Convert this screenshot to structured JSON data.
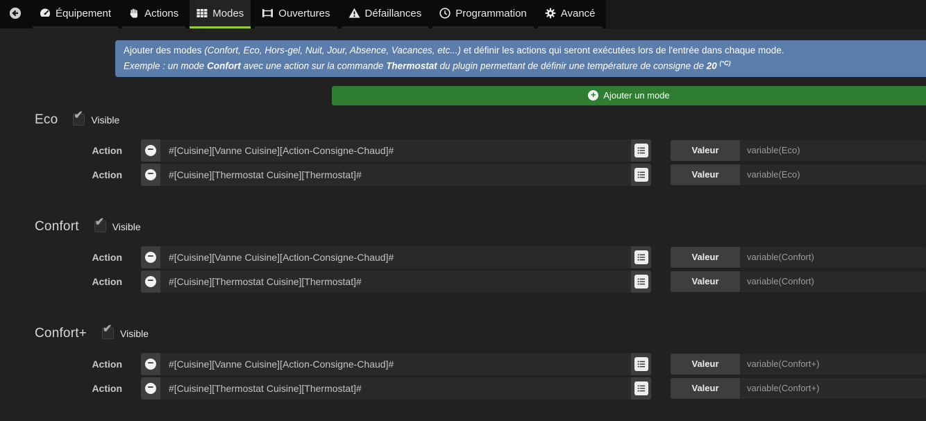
{
  "nav": {
    "back_icon": "arrow-circle-left",
    "tabs": [
      {
        "label": "Équipement",
        "icon": "tachometer",
        "active": false
      },
      {
        "label": "Actions",
        "icon": "hand",
        "active": false
      },
      {
        "label": "Modes",
        "icon": "table-grid",
        "active": true
      },
      {
        "label": "Ouvertures",
        "icon": "window-frame",
        "active": false
      },
      {
        "label": "Défaillances",
        "icon": "warning-triangle",
        "active": false
      },
      {
        "label": "Programmation",
        "icon": "clock",
        "active": false
      },
      {
        "label": "Avancé",
        "icon": "gear",
        "active": false
      }
    ]
  },
  "banner": {
    "line1_prefix": "Ajouter des modes ",
    "line1_italic": "(Confort, Eco, Hors-gel, Nuit, Jour, Absence, Vacances, etc...)",
    "line1_suffix": " et définir les actions qui seront exécutées lors de l'entrée dans chaque mode.",
    "line2_prefix": "Exemple : un mode ",
    "line2_bold1": "Confort",
    "line2_mid1": " avec une action sur la commande ",
    "line2_bold2": "Thermostat",
    "line2_mid2": " du plugin permettant de définir une température de consigne de ",
    "line2_bold3": "20",
    "line2_sup": "(°C)"
  },
  "add_button": {
    "label": "Ajouter un mode"
  },
  "labels": {
    "visible": "Visible",
    "action": "Action",
    "valeur": "Valeur"
  },
  "icons": {
    "plus_glyph": "+",
    "minus_glyph": "−",
    "check_glyph": "✔"
  },
  "colors": {
    "accent_green": "#9acd32",
    "button_green": "#2e7d33",
    "banner_blue": "#5b7dac",
    "page_bg": "#212121",
    "nav_bg": "#0b0b0b"
  },
  "modes": [
    {
      "name": "Eco",
      "visible": true,
      "actions": [
        {
          "command": "#[Cuisine][Vanne Cuisine][Action-Consigne-Chaud]#",
          "value": "variable(Eco)"
        },
        {
          "command": "#[Cuisine][Thermostat Cuisine][Thermostat]#",
          "value": "variable(Eco)"
        }
      ]
    },
    {
      "name": "Confort",
      "visible": true,
      "actions": [
        {
          "command": "#[Cuisine][Vanne Cuisine][Action-Consigne-Chaud]#",
          "value": "variable(Confort)"
        },
        {
          "command": "#[Cuisine][Thermostat Cuisine][Thermostat]#",
          "value": "variable(Confort)"
        }
      ]
    },
    {
      "name": "Confort+",
      "visible": true,
      "actions": [
        {
          "command": "#[Cuisine][Vanne Cuisine][Action-Consigne-Chaud]#",
          "value": "variable(Confort+)"
        },
        {
          "command": "#[Cuisine][Thermostat Cuisine][Thermostat]#",
          "value": "variable(Confort+)"
        }
      ]
    }
  ]
}
